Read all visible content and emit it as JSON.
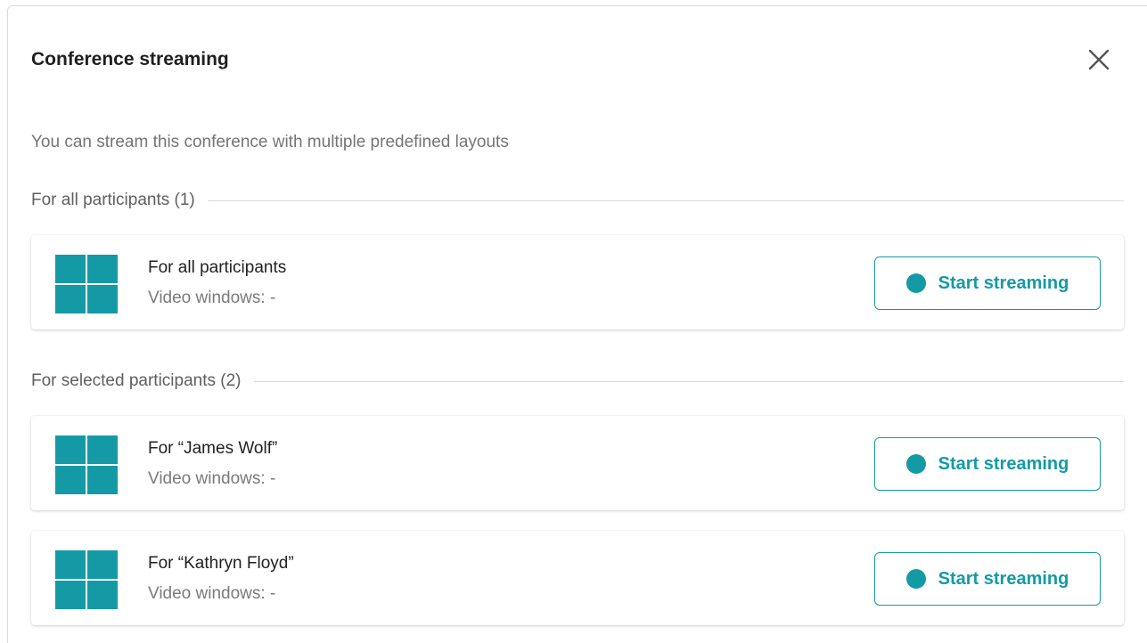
{
  "dialog": {
    "title": "Conference streaming",
    "subtitle": "You can stream this conference with multiple predefined layouts"
  },
  "sections": {
    "all": {
      "label": "For all participants (1)",
      "items": [
        {
          "title": "For all participants",
          "video_windows": "Video windows: -",
          "button_label": "Start streaming"
        }
      ]
    },
    "selected": {
      "label": "For selected participants (2)",
      "items": [
        {
          "title": "For “James Wolf”",
          "video_windows": "Video windows: -",
          "button_label": "Start streaming"
        },
        {
          "title": "For “Kathryn Floyd”",
          "video_windows": "Video windows: -",
          "button_label": "Start streaming"
        }
      ]
    }
  },
  "icons": {
    "close": "close-icon",
    "layout": "grid-layout-icon",
    "record": "record-dot-icon"
  },
  "colors": {
    "accent": "#149aa5",
    "title_text": "#1f1f1f",
    "muted_text": "#757575"
  }
}
